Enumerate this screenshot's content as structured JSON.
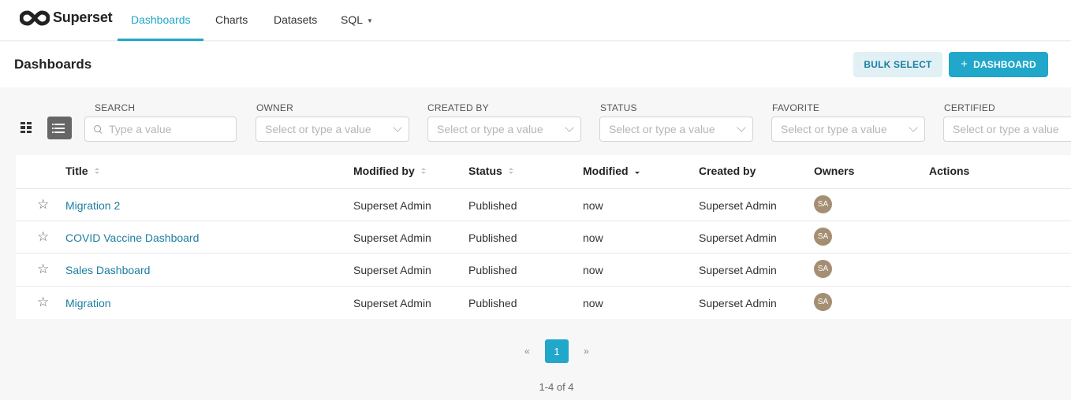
{
  "brand": {
    "name": "Superset"
  },
  "nav": {
    "items": [
      {
        "label": "Dashboards",
        "active": true
      },
      {
        "label": "Charts"
      },
      {
        "label": "Datasets"
      },
      {
        "label": "SQL"
      }
    ]
  },
  "header": {
    "title": "Dashboards",
    "bulk_select_label": "BULK SELECT",
    "add_dashboard_label": "DASHBOARD"
  },
  "filters": {
    "search": {
      "label": "SEARCH",
      "placeholder": "Type a value"
    },
    "owner": {
      "label": "OWNER",
      "placeholder": "Select or type a value"
    },
    "created_by": {
      "label": "CREATED BY",
      "placeholder": "Select or type a value"
    },
    "status": {
      "label": "STATUS",
      "placeholder": "Select or type a value"
    },
    "favorite": {
      "label": "FAVORITE",
      "placeholder": "Select or type a value"
    },
    "certified": {
      "label": "CERTIFIED",
      "placeholder": "Select or type a value"
    }
  },
  "table": {
    "columns": [
      "Title",
      "Modified by",
      "Status",
      "Modified",
      "Created by",
      "Owners",
      "Actions"
    ],
    "rows": [
      {
        "title": "Migration 2",
        "modified_by": "Superset Admin",
        "status": "Published",
        "modified": "now",
        "created_by": "Superset Admin",
        "owner_initials": "SA"
      },
      {
        "title": "COVID Vaccine Dashboard",
        "modified_by": "Superset Admin",
        "status": "Published",
        "modified": "now",
        "created_by": "Superset Admin",
        "owner_initials": "SA"
      },
      {
        "title": "Sales Dashboard",
        "modified_by": "Superset Admin",
        "status": "Published",
        "modified": "now",
        "created_by": "Superset Admin",
        "owner_initials": "SA"
      },
      {
        "title": "Migration",
        "modified_by": "Superset Admin",
        "status": "Published",
        "modified": "now",
        "created_by": "Superset Admin",
        "owner_initials": "SA"
      }
    ]
  },
  "pagination": {
    "prev": "«",
    "current": "1",
    "next": "»",
    "count_text": "1-4 of 4"
  },
  "colors": {
    "accent": "#20a7c9",
    "link": "#1c7ea0",
    "avatar": "#a48f73",
    "bulk_bg": "#e0f0f5"
  }
}
